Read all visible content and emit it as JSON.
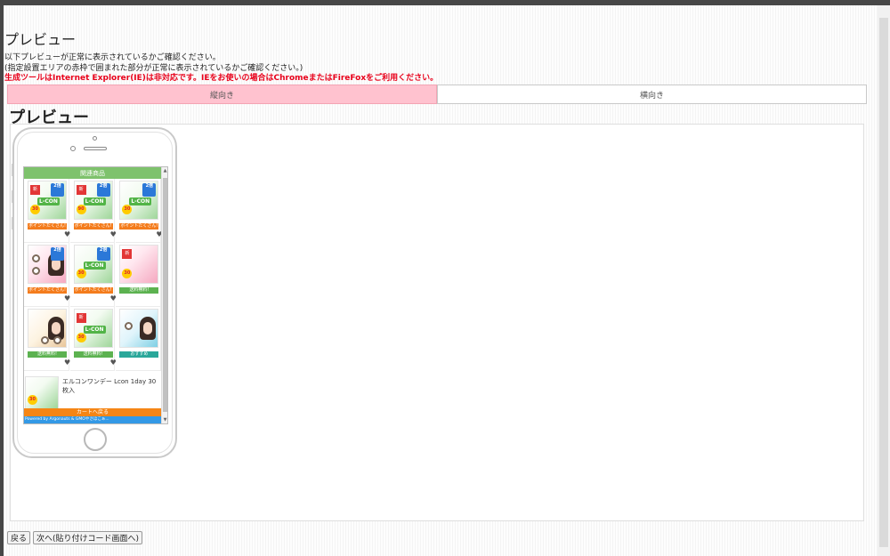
{
  "page": {
    "title": "プレビュー",
    "notices": [
      "以下プレビューが正常に表示されているかご確認ください。",
      "(指定設置エリアの赤枠で囲まれた部分が正常に表示されているかご確認ください。)",
      "生成ツールはInternet Explorer(IE)は非対応です。IEをお使いの場合はChromeまたはFireFoxをご利用ください。"
    ]
  },
  "tabs": [
    {
      "label": "縦向き",
      "active": true
    },
    {
      "label": "横向き",
      "active": false
    }
  ],
  "preview": {
    "heading": "プレビュー",
    "screen": {
      "header": "関連商品",
      "products": [
        {
          "banner": "ポイントたくさん!",
          "badge": "2倍",
          "brand": "L-CON"
        },
        {
          "banner": "ポイントたくさん!",
          "badge": "2倍",
          "brand": "L-CON"
        },
        {
          "banner": "ポイントたくさん!",
          "badge": "2倍",
          "brand": "L-CON"
        },
        {
          "banner": "ポイントたくさん!",
          "badge": "2倍",
          "brand": ""
        },
        {
          "banner": "ポイントたくさん!",
          "badge": "2倍",
          "brand": "L-CON"
        },
        {
          "banner": "送料無料!",
          "badge": "",
          "brand": ""
        },
        {
          "banner": "送料無料!",
          "badge": "",
          "brand": ""
        },
        {
          "banner": "送料無料!",
          "badge": "",
          "brand": "L-CON"
        },
        {
          "banner": "おすすめ",
          "badge": "",
          "brand": ""
        }
      ],
      "list_item": {
        "title": "エルコンワンデー Lcon 1day 30枚入"
      },
      "cart_button": "カートへ戻る",
      "powered_by": "Powered by Argonauts & GMOやさほこぁ..."
    }
  },
  "buttons": {
    "back": "戻る",
    "next": "次へ(貼り付けコード画面へ)"
  },
  "colors": {
    "tab_active": "#ffc2cf",
    "warning": "#e8001a",
    "screen_header": "#7ec26c",
    "cart_bar": "#f58515",
    "powered_bar": "#3399e6"
  },
  "icons": {
    "heart": "heart-icon",
    "scroll_up": "arrow-up-icon",
    "scroll_down": "arrow-down-icon"
  }
}
